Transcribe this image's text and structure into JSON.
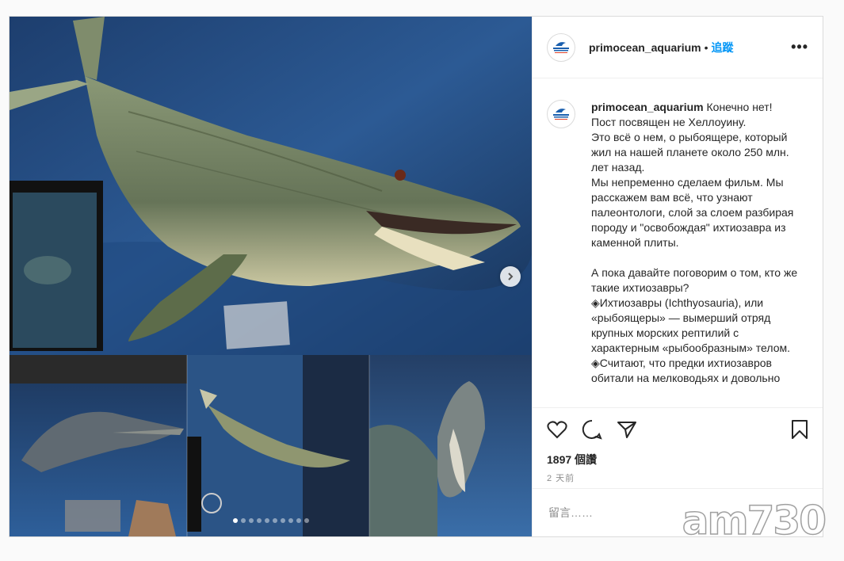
{
  "account": {
    "username": "primocean_aquarium",
    "separator": "•",
    "follow_label": "追蹤",
    "more_label": "•••",
    "avatar_icon": "dolphin-logo-icon"
  },
  "caption": {
    "username": "primocean_aquarium",
    "lines": [
      "Конечно нет!",
      "Пост посвящен не Хеллоуину.",
      "Это всё о нем, о рыбоящере, который жил на нашей планете около 250 млн. лет назад.",
      "Мы непременно сделаем фильм. Мы расскажем вам всё, что узнают палеонтологи, слой за слоем разбирая породу и \"освобождая\" ихтиозавра из каменной плиты.",
      "",
      "А пока давайте поговорим о том, кто же такие ихтиозавры?",
      "◈Ихтиозавры (Ichthyosauria), или «рыбоящеры» — вымерший отряд крупных морских рептилий с характерным «рыбообразным» телом.",
      "◈Считают, что предки ихтиозавров обитали на мелководьях и довольно"
    ]
  },
  "actions": {
    "like_icon": "heart-icon",
    "comment_icon": "comment-bubble-icon",
    "share_icon": "paper-plane-icon",
    "save_icon": "bookmark-icon"
  },
  "stats": {
    "views": "1897 個讚",
    "time_ago": "2 天前"
  },
  "comment": {
    "placeholder": "留言……"
  },
  "carousel": {
    "total_slides": 10,
    "active_index": 0,
    "next_icon": "chevron-right-icon"
  },
  "watermark": {
    "text": "am730"
  },
  "colors": {
    "link_blue": "#0095f6",
    "border": "#dbdbdb",
    "text": "#262626",
    "muted": "#8e8e8e"
  }
}
